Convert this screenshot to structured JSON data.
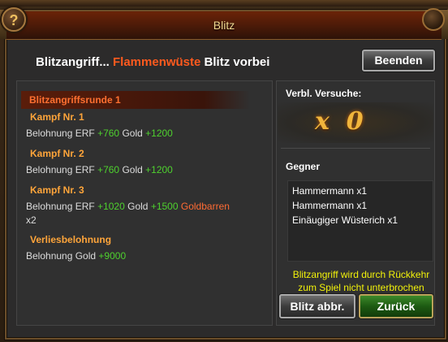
{
  "window": {
    "title": "Blitz",
    "help_glyph": "?"
  },
  "header": {
    "prefix": "Blitzangriff...",
    "location": "Flammenwüste",
    "status": "Blitz vorbei",
    "end_button": "Beenden"
  },
  "rounds": {
    "title": "Blitzangriffsrunde 1",
    "fights": [
      {
        "title": "Kampf Nr. 1",
        "reward_prefix": "Belohnung ERF",
        "erf": "+760",
        "gold_label": "Gold",
        "gold": "+1200"
      },
      {
        "title": "Kampf Nr. 2",
        "reward_prefix": "Belohnung ERF",
        "erf": "+760",
        "gold_label": "Gold",
        "gold": "+1200"
      },
      {
        "title": "Kampf Nr. 3",
        "reward_prefix": "Belohnung ERF",
        "erf": "+1020",
        "gold_label": "Gold",
        "gold": "+1500",
        "extra_item": "Goldbarren",
        "extra_count": "x2"
      }
    ],
    "dungeon": {
      "title": "Verliesbelohnung",
      "reward_prefix": "Belohnung Gold",
      "gold": "+9000"
    }
  },
  "side": {
    "tries_label": "Verbl. Versuche:",
    "tries_x": "x",
    "tries_value": "0",
    "enemies_label": "Gegner",
    "enemies": [
      "Hammermann x1",
      "Hammermann x1",
      "Einäugiger Wüsterich x1"
    ],
    "notice_line1": "Blitzangriff wird durch Rückkehr",
    "notice_line2": "zum Spiel nicht unterbrochen",
    "abort_button": "Blitz abbr.",
    "back_button": "Zurück"
  },
  "colors": {
    "accent_orange": "#ff5a1e",
    "reward_green": "#4ed12e",
    "notice_yellow": "#f2f20a",
    "title_gold": "#f0d890"
  }
}
